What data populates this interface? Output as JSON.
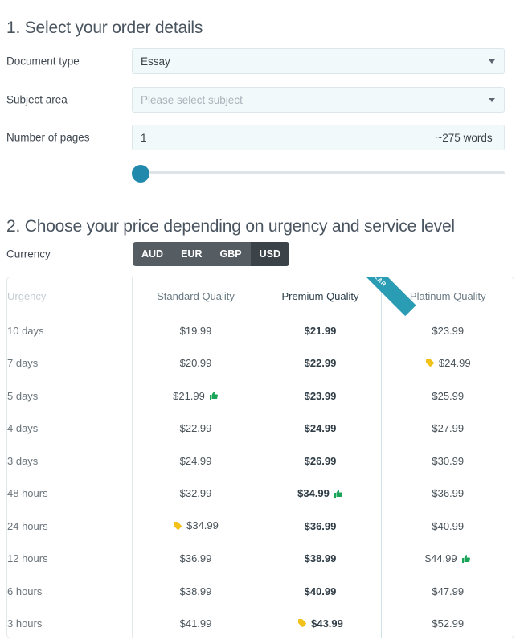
{
  "sections": {
    "step1_title": "1. Select your order details",
    "step2_title": "2. Choose your price depending on urgency and service level"
  },
  "form": {
    "document_type": {
      "label": "Document type",
      "value": "Essay",
      "icon": "chevron-down-icon"
    },
    "subject_area": {
      "label": "Subject area",
      "value": "",
      "placeholder": "Please select subject",
      "icon": "chevron-down-icon"
    },
    "pages": {
      "label": "Number of pages",
      "value": "1",
      "word_count": "~275 words"
    },
    "slider": {
      "position_percent": 0
    }
  },
  "currency": {
    "label": "Currency",
    "options": [
      "AUD",
      "EUR",
      "GBP",
      "USD"
    ],
    "selected": "USD"
  },
  "price_table": {
    "headers": [
      "Urgency",
      "Standard Quality",
      "Premium Quality",
      "Platinum Quality"
    ],
    "popular_badge": "POPULAR",
    "popular_column": "Premium Quality",
    "rows": [
      {
        "urgency": "10 days",
        "standard": "$19.99",
        "standard_icon": "",
        "premium": "$21.99",
        "premium_icon": "",
        "platinum": "$23.99",
        "platinum_icon": ""
      },
      {
        "urgency": "7 days",
        "standard": "$20.99",
        "standard_icon": "",
        "premium": "$22.99",
        "premium_icon": "",
        "platinum": "$24.99",
        "platinum_icon": "tag-icon"
      },
      {
        "urgency": "5 days",
        "standard": "$21.99",
        "standard_icon": "thumbs-up-icon",
        "premium": "$23.99",
        "premium_icon": "",
        "platinum": "$25.99",
        "platinum_icon": ""
      },
      {
        "urgency": "4 days",
        "standard": "$22.99",
        "standard_icon": "",
        "premium": "$24.99",
        "premium_icon": "",
        "platinum": "$27.99",
        "platinum_icon": ""
      },
      {
        "urgency": "3 days",
        "standard": "$24.99",
        "standard_icon": "",
        "premium": "$26.99",
        "premium_icon": "",
        "platinum": "$30.99",
        "platinum_icon": ""
      },
      {
        "urgency": "48 hours",
        "standard": "$32.99",
        "standard_icon": "",
        "premium": "$34.99",
        "premium_icon": "thumbs-up-icon",
        "platinum": "$36.99",
        "platinum_icon": ""
      },
      {
        "urgency": "24 hours",
        "standard": "$34.99",
        "standard_icon": "tag-icon",
        "premium": "$36.99",
        "premium_icon": "",
        "platinum": "$40.99",
        "platinum_icon": ""
      },
      {
        "urgency": "12 hours",
        "standard": "$36.99",
        "standard_icon": "",
        "premium": "$38.99",
        "premium_icon": "",
        "platinum": "$44.99",
        "platinum_icon": "thumbs-up-icon"
      },
      {
        "urgency": "6 hours",
        "standard": "$38.99",
        "standard_icon": "",
        "premium": "$40.99",
        "premium_icon": "",
        "platinum": "$47.99",
        "platinum_icon": ""
      },
      {
        "urgency": "3 hours",
        "standard": "$41.99",
        "standard_icon": "",
        "premium": "$43.99",
        "premium_icon": "tag-icon",
        "platinum": "$52.99",
        "platinum_icon": ""
      }
    ]
  },
  "colors": {
    "accent_teal": "#2189ab",
    "ribbon_teal": "#2a9db5",
    "thumbs_green": "#18a558",
    "tag_yellow": "#f2c21a",
    "heading_gray": "#4a5560",
    "currency_bar": "#555d63",
    "currency_active": "#3b4248"
  }
}
